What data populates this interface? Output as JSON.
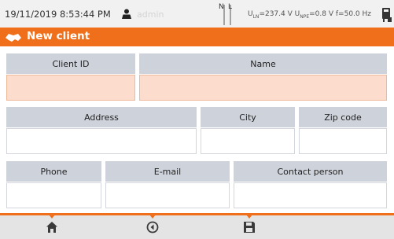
{
  "status": {
    "datetime": "19/11/2019 8:53:44 PM",
    "user": "admin",
    "n_label": "N",
    "l_label": "L",
    "u_ln_label": "U",
    "u_ln_sub": "LN",
    "u_ln_value": "=237.4 V",
    "u_npe_label": "U",
    "u_npe_sub": "NPE",
    "u_npe_value": "=0.8 V",
    "frequency": "f=50.0 Hz",
    "icons": [
      "user-icon",
      "power-plug-icon"
    ]
  },
  "title": {
    "text": "New client",
    "icon": "client-icon",
    "color": "#ef6f1a"
  },
  "form": {
    "client_id": {
      "label": "Client ID",
      "value": ""
    },
    "name": {
      "label": "Name",
      "value": ""
    },
    "address": {
      "label": "Address",
      "value": ""
    },
    "city": {
      "label": "City",
      "value": ""
    },
    "zip_code": {
      "label": "Zip code",
      "value": ""
    },
    "phone": {
      "label": "Phone",
      "value": ""
    },
    "email": {
      "label": "E-mail",
      "value": ""
    },
    "contact_person": {
      "label": "Contact person",
      "value": ""
    },
    "required_field_color": "#fcdccc"
  },
  "bottom": {
    "icons": [
      "home-icon",
      "back-icon",
      "save-icon"
    ]
  }
}
